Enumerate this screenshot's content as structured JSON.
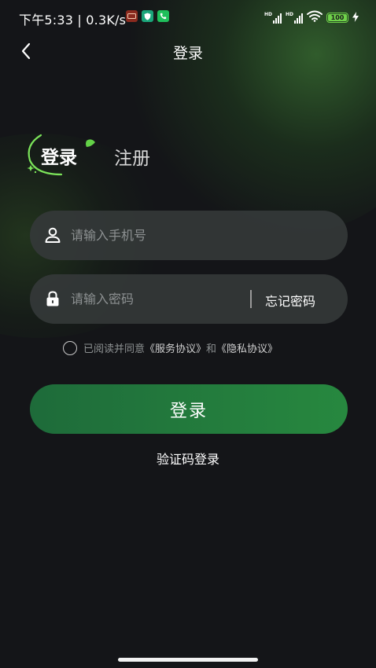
{
  "status_bar": {
    "time_speed": "下午5:33 | 0.3K/s",
    "network_type_1": "HD",
    "network_type_2": "HD",
    "battery_level": "100",
    "notification_icons": [
      "app-notification-icon",
      "shield-app-icon",
      "phone-app-icon"
    ],
    "system_icons": [
      "signal-icon",
      "signal-icon",
      "wifi-icon",
      "battery-icon",
      "charging-icon"
    ]
  },
  "nav": {
    "back_icon": "chevron-left-icon",
    "title": "登录"
  },
  "tabs": {
    "login": "登录",
    "register": "注册",
    "active": "login"
  },
  "form": {
    "phone": {
      "placeholder": "请输入手机号",
      "value": "",
      "icon": "user-icon"
    },
    "password": {
      "placeholder": "请输入密码",
      "value": "",
      "icon": "lock-icon"
    },
    "forgot_label": "忘记密码"
  },
  "agreement": {
    "prefix": "已阅读并同意",
    "service_link": "《服务协议》",
    "conjunction": "和",
    "privacy_link": "《隐私协议》",
    "checked": false
  },
  "actions": {
    "login_label": "登录",
    "sms_login_label": "验证码登录"
  },
  "colors": {
    "background": "#141518",
    "accent_green": "#27883f",
    "field_background": "#343838"
  }
}
